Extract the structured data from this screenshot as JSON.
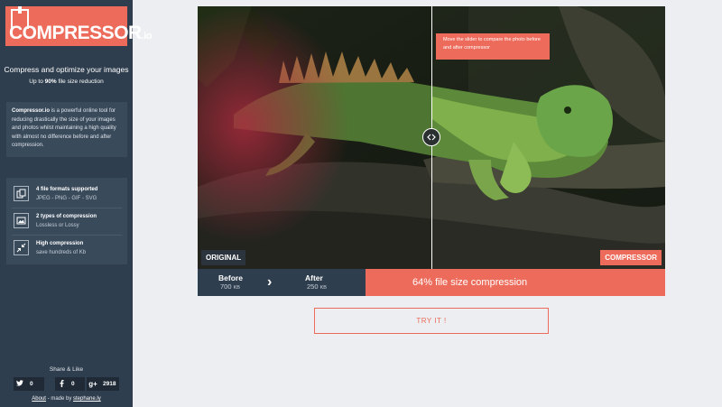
{
  "brand": {
    "name": "Compressor",
    "name_first": "C",
    "name_rest": "OMPRESSOR",
    "tld": ".io",
    "accent": "#ed6b5b",
    "sidebar_bg": "#2f3e4e"
  },
  "tagline": {
    "title": "Compress and optimize your images",
    "sub_pre": "Up to ",
    "sub_bold": "90%",
    "sub_post": " file size reduction"
  },
  "description": {
    "bold": "Compressor.io",
    "text": " is a powerful online tool for reducing drastically the size of your images and photos whilst maintaining a high quality with almost no difference before and after compression."
  },
  "features": [
    {
      "icon": "copy-icon",
      "title": "4 file formats supported",
      "sub": "JPEG - PNG - GIF - SVG"
    },
    {
      "icon": "image-icon",
      "title": "2 types of compression",
      "sub": "Lossless or Lossy"
    },
    {
      "icon": "compress-arrows-icon",
      "title": "High compression",
      "sub": "save hundreds of Kb"
    }
  ],
  "share": {
    "title": "Share & Like",
    "twitter": {
      "icon": "twitter-icon",
      "count": "0"
    },
    "facebook": {
      "icon": "facebook-icon",
      "count": "0"
    },
    "gplus": {
      "icon": "google-plus-icon",
      "count": "2918"
    }
  },
  "about": {
    "link": "About",
    "text": " - made by ",
    "author": "stephane.ly"
  },
  "comparison": {
    "tooltip": "Move the slider to compare the photo before and after compressor",
    "label_left": "ORIGINAL",
    "label_right": "COMPRESSOR",
    "handle_glyph": "‹›"
  },
  "stats": {
    "before_label": "Before",
    "before_value": "700",
    "before_unit": "KB",
    "after_label": "After",
    "after_value": "250",
    "after_unit": "KB",
    "arrow": "›",
    "ratio_text": "64% file size compression"
  },
  "cta": {
    "label": "TRY IT !"
  }
}
